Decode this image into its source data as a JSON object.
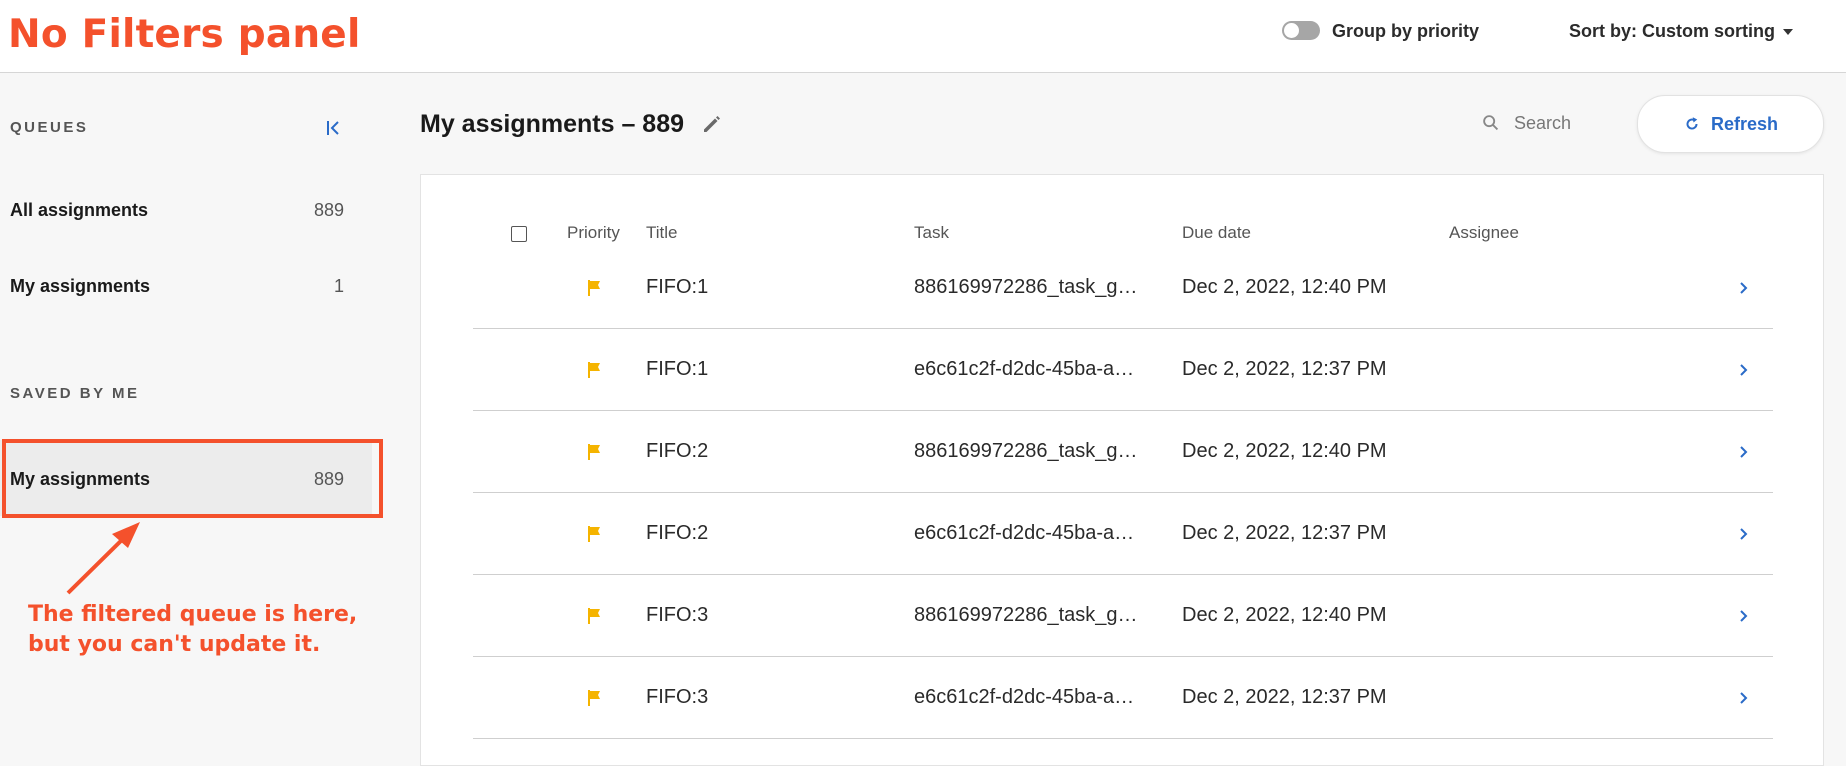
{
  "annotation": {
    "title": "No Filters panel",
    "note": "The filtered queue is here, but you can't update it.",
    "color": "#f4512c"
  },
  "header": {
    "group_toggle_label": "Group by priority",
    "group_toggle_on": false,
    "sort_label": "Sort by: Custom sorting"
  },
  "sidebar": {
    "queues_heading": "QUEUES",
    "saved_heading": "SAVED BY ME",
    "queues": [
      {
        "label": "All assignments",
        "count": "889"
      },
      {
        "label": "My assignments",
        "count": "1"
      }
    ],
    "saved": [
      {
        "label": "My assignments",
        "count": "889"
      }
    ]
  },
  "main": {
    "title": "My assignments – 889",
    "search_placeholder": "Search",
    "refresh_label": "Refresh",
    "columns": [
      "Priority",
      "Title",
      "Task",
      "Due date",
      "Assignee"
    ],
    "rows": [
      {
        "title": "FIFO:1",
        "task": "886169972286_task_g…",
        "due": "Dec 2, 2022, 12:40 PM",
        "assignee": ""
      },
      {
        "title": "FIFO:1",
        "task": "e6c61c2f-d2dc-45ba-a…",
        "due": "Dec 2, 2022, 12:37 PM",
        "assignee": ""
      },
      {
        "title": "FIFO:2",
        "task": "886169972286_task_g…",
        "due": "Dec 2, 2022, 12:40 PM",
        "assignee": ""
      },
      {
        "title": "FIFO:2",
        "task": "e6c61c2f-d2dc-45ba-a…",
        "due": "Dec 2, 2022, 12:37 PM",
        "assignee": ""
      },
      {
        "title": "FIFO:3",
        "task": "886169972286_task_g…",
        "due": "Dec 2, 2022, 12:40 PM",
        "assignee": ""
      },
      {
        "title": "FIFO:3",
        "task": "e6c61c2f-d2dc-45ba-a…",
        "due": "Dec 2, 2022, 12:37 PM",
        "assignee": ""
      }
    ]
  },
  "colors": {
    "accent": "#2a6bc8",
    "flag": "#f5b400"
  }
}
